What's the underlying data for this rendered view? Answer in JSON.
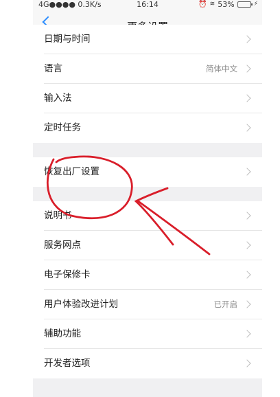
{
  "status_bar": {
    "left": "4G●●●● 0.3K/s",
    "time": "16:14",
    "battery_percent": "53%",
    "battery_level": 0.53
  },
  "nav": {
    "title": "更多设置",
    "back_icon": "chevron-left-icon"
  },
  "groups": [
    {
      "items": [
        {
          "label": "日期与时间",
          "value": ""
        },
        {
          "label": "语言",
          "value": "简体中文"
        },
        {
          "label": "输入法",
          "value": ""
        },
        {
          "label": "定时任务",
          "value": ""
        }
      ]
    },
    {
      "items": [
        {
          "label": "恢复出厂设置",
          "value": ""
        }
      ]
    },
    {
      "items": [
        {
          "label": "说明书",
          "value": ""
        },
        {
          "label": "服务网点",
          "value": ""
        },
        {
          "label": "电子保修卡",
          "value": ""
        },
        {
          "label": "用户体验改进计划",
          "value": "已开启"
        },
        {
          "label": "辅助功能",
          "value": ""
        },
        {
          "label": "开发者选项",
          "value": ""
        }
      ]
    }
  ],
  "colors": {
    "accent": "#2a8cff",
    "annotation": "#d91e2a"
  }
}
